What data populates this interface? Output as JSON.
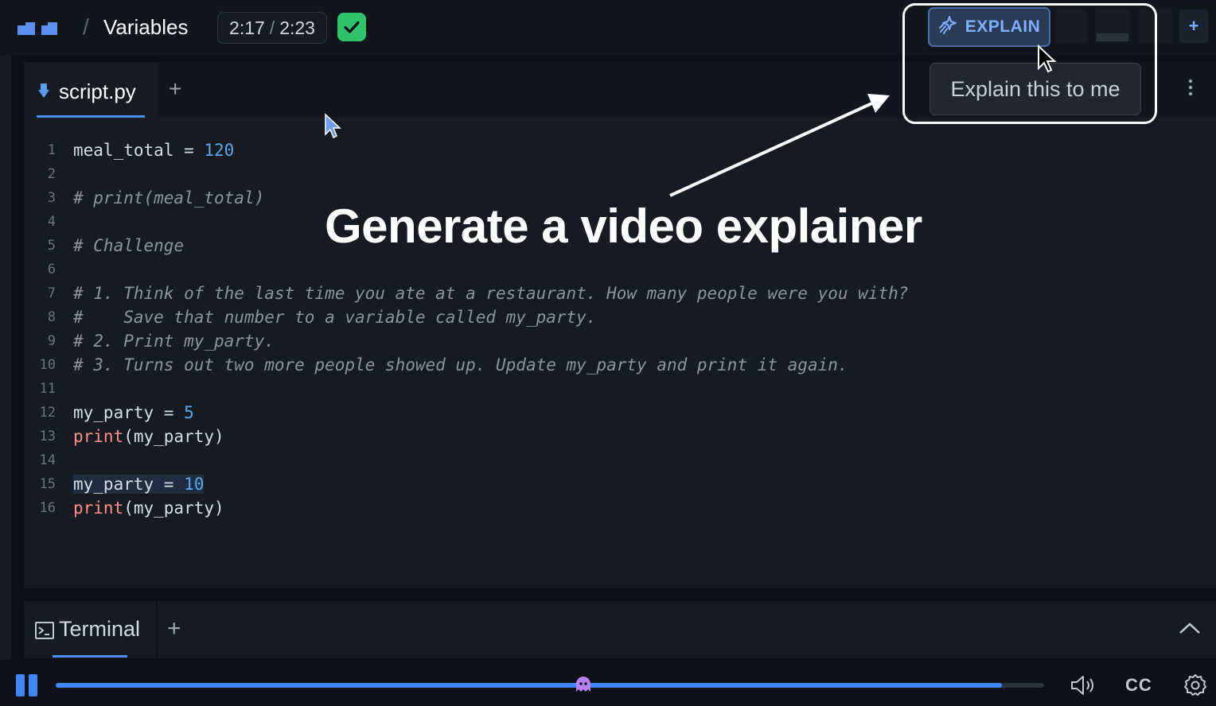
{
  "header": {
    "breadcrumb_title": "Variables",
    "time_current": "2:17",
    "time_separator": "/",
    "time_total": "2:23",
    "explain_label": "EXPLAIN",
    "add_label": "+"
  },
  "tooltip": {
    "text": "Explain this to me"
  },
  "annotation": {
    "caption": "Generate a video explainer"
  },
  "editor": {
    "tab_label": "script.py",
    "add_tab_label": "+",
    "lines": [
      {
        "n": "1",
        "segments": [
          {
            "t": "meal_total = ",
            "c": ""
          },
          {
            "t": "120",
            "c": "num"
          }
        ]
      },
      {
        "n": "2",
        "segments": []
      },
      {
        "n": "3",
        "segments": [
          {
            "t": "# print(meal_total)",
            "c": "cmt"
          }
        ]
      },
      {
        "n": "4",
        "segments": []
      },
      {
        "n": "5",
        "segments": [
          {
            "t": "# Challenge",
            "c": "cmt"
          }
        ]
      },
      {
        "n": "6",
        "segments": []
      },
      {
        "n": "7",
        "segments": [
          {
            "t": "# 1. Think of the last time you ate at a restaurant. How many people were you with?",
            "c": "cmt"
          }
        ]
      },
      {
        "n": "8",
        "segments": [
          {
            "t": "#    Save that number to a variable called my_party.",
            "c": "cmt"
          }
        ]
      },
      {
        "n": "9",
        "segments": [
          {
            "t": "# 2. Print my_party.",
            "c": "cmt"
          }
        ]
      },
      {
        "n": "10",
        "segments": [
          {
            "t": "# 3. Turns out two more people showed up. Update my_party and print it again.",
            "c": "cmt"
          }
        ]
      },
      {
        "n": "11",
        "segments": []
      },
      {
        "n": "12",
        "segments": [
          {
            "t": "my_party = ",
            "c": ""
          },
          {
            "t": "5",
            "c": "num"
          }
        ]
      },
      {
        "n": "13",
        "segments": [
          {
            "t": "print",
            "c": "fn"
          },
          {
            "t": "(my_party)",
            "c": ""
          }
        ]
      },
      {
        "n": "14",
        "segments": []
      },
      {
        "n": "15",
        "segments": [
          {
            "t": "my_party = ",
            "c": "selected"
          },
          {
            "t": "10",
            "c": "num selected"
          }
        ]
      },
      {
        "n": "16",
        "segments": [
          {
            "t": "print",
            "c": "fn"
          },
          {
            "t": "(my_party)",
            "c": ""
          }
        ]
      }
    ]
  },
  "terminal": {
    "tab_label": "Terminal",
    "add_label": "+"
  },
  "player": {
    "progress_fraction": 0.957,
    "cc_label": "CC"
  },
  "colors": {
    "accent": "#3f86ff",
    "check": "#2fc46c",
    "explain_text": "#7eb0ff"
  },
  "icons": [
    "logo-icon",
    "check-icon",
    "sparkle-icon",
    "file-icon",
    "kebab-icon",
    "terminal-icon",
    "chevron-up-icon",
    "pause-icon",
    "ghost-thumb-icon",
    "volume-icon",
    "gear-icon",
    "cursor-icon"
  ]
}
